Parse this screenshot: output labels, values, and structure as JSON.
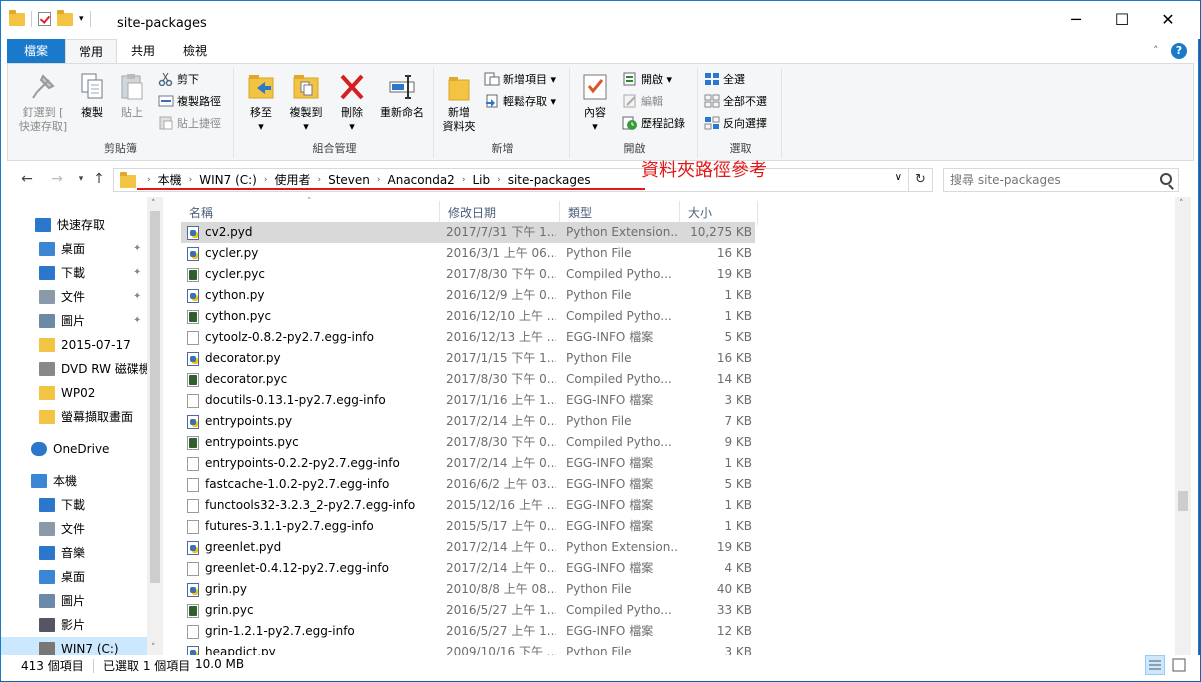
{
  "window": {
    "title": "site-packages",
    "controls": [
      "─",
      "☐",
      "✕"
    ]
  },
  "ribbon_tabs": [
    "檔案",
    "常用",
    "共用",
    "檢視"
  ],
  "ribbon": {
    "clipboard": {
      "label": "剪貼簿",
      "pin": "釘選到 [\n快速存取]",
      "copy": "複製",
      "paste": "貼上",
      "cut": "剪下",
      "copy_path": "複製路徑",
      "paste_shortcut": "貼上捷徑"
    },
    "organize": {
      "label": "組合管理",
      "move_to": "移至",
      "copy_to": "複製到",
      "delete": "刪除",
      "rename": "重新命名"
    },
    "new": {
      "label": "新增",
      "new_folder": "新增\n資料夾",
      "new_item": "新增項目",
      "easy_access": "輕鬆存取"
    },
    "open": {
      "label": "開啟",
      "properties": "內容",
      "open": "開啟",
      "edit": "編輯",
      "history": "歷程記錄"
    },
    "select": {
      "label": "選取",
      "select_all": "全選",
      "select_none": "全部不選",
      "invert": "反向選擇"
    }
  },
  "address": {
    "crumbs": [
      "本機",
      "WIN7 (C:)",
      "使用者",
      "Steven",
      "Anaconda2",
      "Lib",
      "site-packages"
    ],
    "annotation": "資料夾路徑參考"
  },
  "search": {
    "placeholder": "搜尋 site-packages"
  },
  "sidebar": {
    "items": [
      {
        "label": "快速存取",
        "icon": "star-icon"
      },
      {
        "label": "桌面",
        "icon": "desktop-icon",
        "pinned": true
      },
      {
        "label": "下載",
        "icon": "download-icon",
        "pinned": true
      },
      {
        "label": "文件",
        "icon": "document-icon",
        "pinned": true
      },
      {
        "label": "圖片",
        "icon": "pictures-icon",
        "pinned": true
      },
      {
        "label": "2015-07-17",
        "icon": "folder-icon"
      },
      {
        "label": "DVD RW 磁碟機",
        "icon": "dvd-icon"
      },
      {
        "label": "WP02",
        "icon": "folder-icon"
      },
      {
        "label": "螢幕擷取畫面",
        "icon": "folder-icon"
      },
      {
        "label": "OneDrive",
        "icon": "cloud-icon"
      },
      {
        "label": "本機",
        "icon": "computer-icon"
      },
      {
        "label": "下載",
        "icon": "download-icon"
      },
      {
        "label": "文件",
        "icon": "document-icon"
      },
      {
        "label": "音樂",
        "icon": "music-icon"
      },
      {
        "label": "桌面",
        "icon": "desktop-icon"
      },
      {
        "label": "圖片",
        "icon": "pictures-icon"
      },
      {
        "label": "影片",
        "icon": "video-icon"
      },
      {
        "label": "WIN7 (C:)",
        "icon": "drive-icon"
      }
    ],
    "pin_glyph": "📌"
  },
  "columns": [
    "名稱",
    "修改日期",
    "類型",
    "大小"
  ],
  "files": [
    {
      "name": "cv2.pyd",
      "date": "2017/7/31 下午 1...",
      "type": "Python Extension...",
      "size": "10,275 KB",
      "icon": "py",
      "selected": true
    },
    {
      "name": "cycler.py",
      "date": "2016/3/1 上午 06...",
      "type": "Python File",
      "size": "16 KB",
      "icon": "py"
    },
    {
      "name": "cycler.pyc",
      "date": "2017/8/30 下午 0...",
      "type": "Compiled Pytho...",
      "size": "19 KB",
      "icon": "pyc"
    },
    {
      "name": "cython.py",
      "date": "2016/12/9 上午 0...",
      "type": "Python File",
      "size": "1 KB",
      "icon": "py"
    },
    {
      "name": "cython.pyc",
      "date": "2016/12/10 上午 ...",
      "type": "Compiled Pytho...",
      "size": "1 KB",
      "icon": "pyc"
    },
    {
      "name": "cytoolz-0.8.2-py2.7.egg-info",
      "date": "2016/12/13 上午 ...",
      "type": "EGG-INFO 檔案",
      "size": "5 KB",
      "icon": "file"
    },
    {
      "name": "decorator.py",
      "date": "2017/1/15 下午 1...",
      "type": "Python File",
      "size": "16 KB",
      "icon": "py"
    },
    {
      "name": "decorator.pyc",
      "date": "2017/8/30 下午 0...",
      "type": "Compiled Pytho...",
      "size": "14 KB",
      "icon": "pyc"
    },
    {
      "name": "docutils-0.13.1-py2.7.egg-info",
      "date": "2017/1/16 上午 1...",
      "type": "EGG-INFO 檔案",
      "size": "3 KB",
      "icon": "file"
    },
    {
      "name": "entrypoints.py",
      "date": "2017/2/14 上午 0...",
      "type": "Python File",
      "size": "7 KB",
      "icon": "py"
    },
    {
      "name": "entrypoints.pyc",
      "date": "2017/8/30 下午 0...",
      "type": "Compiled Pytho...",
      "size": "9 KB",
      "icon": "pyc"
    },
    {
      "name": "entrypoints-0.2.2-py2.7.egg-info",
      "date": "2017/2/14 上午 0...",
      "type": "EGG-INFO 檔案",
      "size": "1 KB",
      "icon": "file"
    },
    {
      "name": "fastcache-1.0.2-py2.7.egg-info",
      "date": "2016/6/2 上午 03...",
      "type": "EGG-INFO 檔案",
      "size": "5 KB",
      "icon": "file"
    },
    {
      "name": "functools32-3.2.3_2-py2.7.egg-info",
      "date": "2015/12/16 上午 ...",
      "type": "EGG-INFO 檔案",
      "size": "1 KB",
      "icon": "file"
    },
    {
      "name": "futures-3.1.1-py2.7.egg-info",
      "date": "2015/5/17 上午 0...",
      "type": "EGG-INFO 檔案",
      "size": "1 KB",
      "icon": "file"
    },
    {
      "name": "greenlet.pyd",
      "date": "2017/2/14 上午 0...",
      "type": "Python Extension...",
      "size": "19 KB",
      "icon": "py"
    },
    {
      "name": "greenlet-0.4.12-py2.7.egg-info",
      "date": "2017/2/14 上午 0...",
      "type": "EGG-INFO 檔案",
      "size": "4 KB",
      "icon": "file"
    },
    {
      "name": "grin.py",
      "date": "2010/8/8 上午 08...",
      "type": "Python File",
      "size": "40 KB",
      "icon": "py"
    },
    {
      "name": "grin.pyc",
      "date": "2016/5/27 上午 1...",
      "type": "Compiled Pytho...",
      "size": "33 KB",
      "icon": "pyc"
    },
    {
      "name": "grin-1.2.1-py2.7.egg-info",
      "date": "2016/5/27 上午 1...",
      "type": "EGG-INFO 檔案",
      "size": "12 KB",
      "icon": "file"
    },
    {
      "name": "heapdict.py",
      "date": "2009/10/16 下午 ...",
      "type": "Python File",
      "size": "3 KB",
      "icon": "py"
    }
  ],
  "status": {
    "count": "413 個項目",
    "selected": "已選取 1 個項目",
    "size": "10.0 MB"
  }
}
